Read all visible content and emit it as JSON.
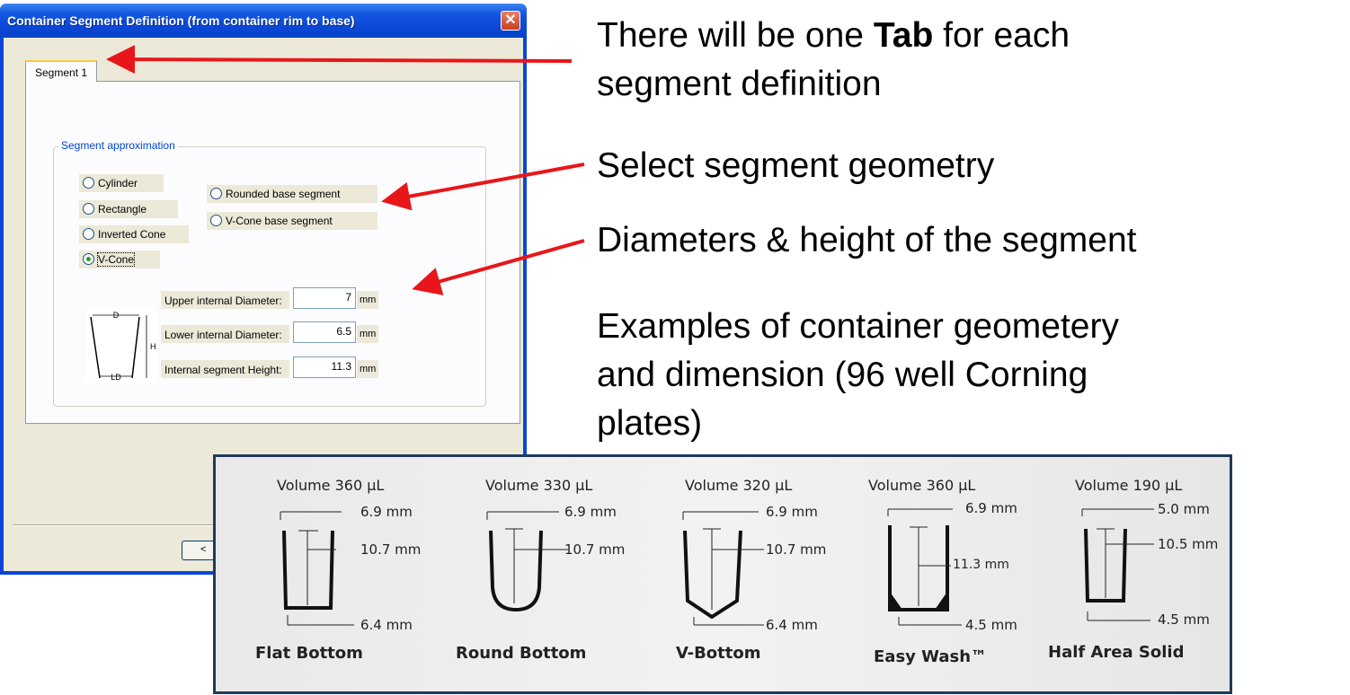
{
  "dialog": {
    "title": "Container Segment Definition (from container rim to base)",
    "close_label": "✕",
    "tab_label": "Segment 1",
    "group_label": "Segment approximation",
    "radios": [
      {
        "label": "Cylinder",
        "checked": false
      },
      {
        "label": "Rectangle",
        "checked": false
      },
      {
        "label": "Inverted Cone",
        "checked": false
      },
      {
        "label": "V-Cone",
        "checked": true
      },
      {
        "label": "Rounded base segment",
        "checked": false
      },
      {
        "label": "V-Cone base segment",
        "checked": false
      }
    ],
    "dimensions": [
      {
        "label": "Upper internal Diameter:",
        "value": "7",
        "unit": "mm"
      },
      {
        "label": "Lower internal Diameter:",
        "value": "6.5",
        "unit": "mm"
      },
      {
        "label": "Internal segment Height:",
        "value": "11.3",
        "unit": "mm"
      }
    ],
    "diagram_labels": {
      "top": "D",
      "height": "H",
      "bottom": "LD"
    },
    "back_button_label": "<"
  },
  "annotations": {
    "tab_line1_pre": "There will be one ",
    "tab_line1_bold": "Tab",
    "tab_line1_post": " for each",
    "tab_line2": "segment definition",
    "geometry": "Select segment geometry",
    "diameters": "Diameters & height of the segment",
    "examples_line1": "Examples of container geometery",
    "examples_line2": "and dimension (96 well Corning",
    "examples_line3": "plates)"
  },
  "wells": [
    {
      "volume": "Volume 360 µL",
      "name": "Flat Bottom",
      "top": "6.9 mm",
      "height": "10.7 mm",
      "bottom": "6.4 mm"
    },
    {
      "volume": "Volume 330 µL",
      "name": "Round Bottom",
      "top": "6.9 mm",
      "height": "10.7 mm",
      "bottom": ""
    },
    {
      "volume": "Volume 320 µL",
      "name": "V-Bottom",
      "top": "6.9 mm",
      "height": "10.7 mm",
      "bottom": "6.4 mm"
    },
    {
      "volume": "Volume 360 µL",
      "name": "Easy Wash™",
      "top": "6.9 mm",
      "height": "11.3 mm",
      "bottom": "4.5 mm"
    },
    {
      "volume": "Volume 190 µL",
      "name": "Half Area Solid",
      "top": "5.0 mm",
      "height": "10.5 mm",
      "bottom": "4.5 mm"
    }
  ],
  "colors": {
    "arrow": "#e8161a",
    "title_blue": "#0a47d6",
    "panel_border": "#1f3a5a"
  }
}
